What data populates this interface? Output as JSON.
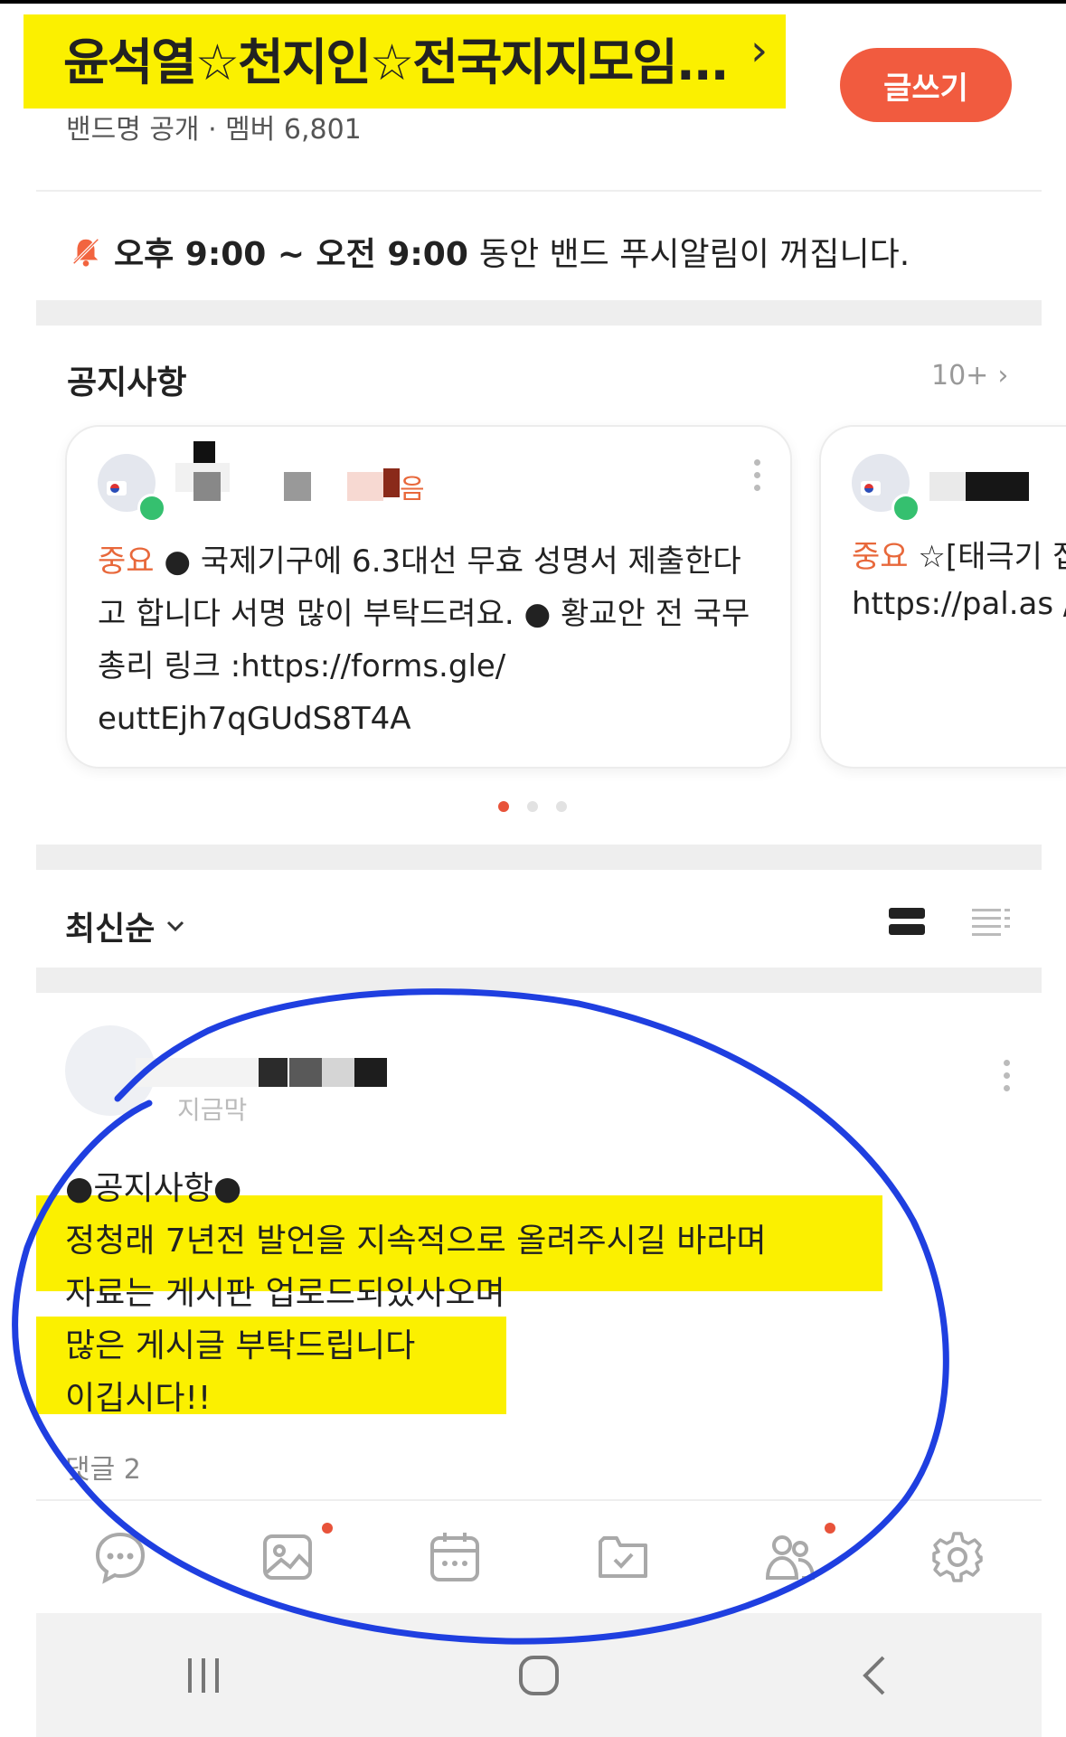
{
  "header": {
    "band_title": "윤석열☆천지인☆전국지지모임...",
    "chevron": "›",
    "band_meta": "밴드명 공개 · 멤버 6,801",
    "write_button": "글쓰기"
  },
  "push_notice": {
    "time_range": "오후 9:00 ~ 오전 9:00",
    "message": "동안 밴드 푸시알림이 꺼집니다."
  },
  "notices": {
    "heading": "공지사항",
    "count": "10+",
    "cards": [
      {
        "author_suffix": "음",
        "tag": "중요",
        "text": "● 국제기구에 6.3대선 무효 성명서 제출한다고 합니다 서명 많이 부탁드려요. ● 황교안 전 국무총리 링크 :https://forms.gle/ euttEjh7qGUdS8T4A"
      },
      {
        "tag": "중요",
        "text": "☆[태극기 집회에서 듣지 https://pal.as /lgsltpaOpn/"
      }
    ]
  },
  "sort": {
    "label": "최신순"
  },
  "post": {
    "time": "지금막",
    "body_lines": [
      "●공지사항●",
      "정청래 7년전 발언을 지속적으로 올려주시길 바라며",
      "자료는 게시판 업로드되있사오며",
      "많은 게시글 부탁드립니다",
      "이깁시다!!"
    ],
    "comments": "댓글 2"
  },
  "colors": {
    "accent": "#f15b3f",
    "highlight": "#fbf000",
    "annotation_circle": "#1f3fe0",
    "badge_green": "#35c06f"
  },
  "nav_icons": [
    "chat-icon",
    "photo-icon",
    "calendar-icon",
    "folder-check-icon",
    "members-icon",
    "settings-icon"
  ]
}
